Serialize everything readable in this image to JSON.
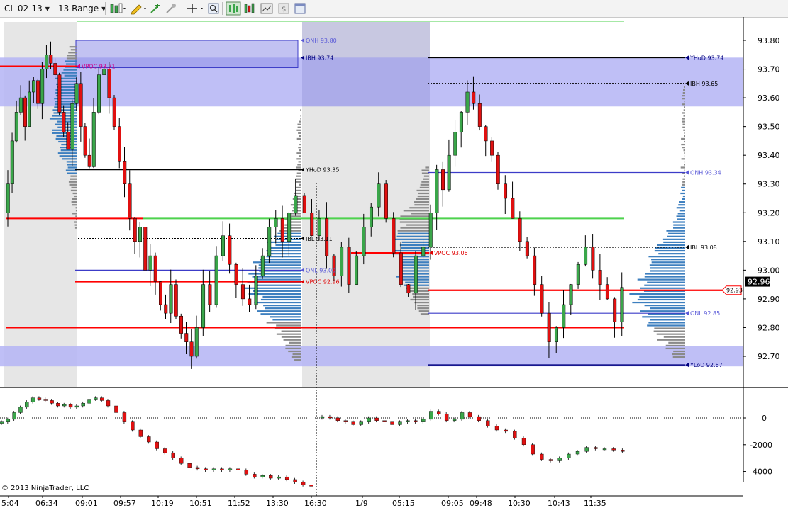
{
  "toolbar": {
    "instrument": "CL 02-13",
    "bar_type": "13 Range",
    "icons": [
      "bar-style-icon",
      "drawing-pencil-icon",
      "add-indicator-icon",
      "strategy-icon",
      "crosshair-icon",
      "zoom-icon",
      "data-box-icon",
      "chart-trader-icon",
      "chart-properties-icon",
      "dollar-icon",
      "window-icon"
    ]
  },
  "price_axis": {
    "ticks": [
      "93.80",
      "93.70",
      "93.60",
      "93.50",
      "93.40",
      "93.30",
      "93.20",
      "93.10",
      "93.00",
      "92.90",
      "92.80",
      "92.70"
    ],
    "current_price": "92.96",
    "marker_price": "92.93"
  },
  "oscillator_axis": {
    "ticks": [
      "0",
      "-2000",
      "-4000"
    ]
  },
  "time_axis": {
    "labels": [
      "5:04",
      "06:34",
      "09:01",
      "09:57",
      "10:19",
      "10:51",
      "11:52",
      "13:30",
      "16:30",
      "1/9",
      "05:15",
      "09:05",
      "09:48",
      "10:30",
      "10:43",
      "11:35"
    ]
  },
  "annotations": {
    "onh_1": "ONH 93.80",
    "ibh_1": "IBH 93.74",
    "vpoc_1": "VPOC 93.71",
    "yhod_1": "YHoD 93.35",
    "ibl_1": "IBL 93.11",
    "onl_1": "ONL 93.00",
    "vpoc_2": "VPOC 92.96",
    "yhod_2": "YHoD 93.74",
    "ibh_2": "IBH 93.65",
    "onh_2": "ONH 93.34",
    "ibl_2": "IBL 93.08",
    "vpoc_3": "VPOC 93.06",
    "onl_2": "ONL 92.85",
    "ylod": "YLoD 92.67"
  },
  "copyright": "© 2013 NinjaTrader, LLC",
  "colors": {
    "up": "#3aa64a",
    "down": "#e01010",
    "zone": "#b4b4f5",
    "profile_blue": "#3d7fbf",
    "profile_gray": "#8a8a8a",
    "vpoc": "#ff0000",
    "level_blue": "#3c3cc8"
  },
  "chart_data": [
    {
      "type": "candlestick",
      "title": "",
      "price_range": [
        92.62,
        93.86
      ],
      "price_ticks": [
        93.8,
        93.7,
        93.6,
        93.5,
        93.4,
        93.3,
        93.2,
        93.1,
        93.0,
        92.9,
        92.8,
        92.7
      ],
      "current_price": 92.96,
      "levels": [
        {
          "label": "ONH",
          "price": 93.8
        },
        {
          "label": "IBH",
          "price": 93.74
        },
        {
          "label": "VPOC",
          "price": 93.71
        },
        {
          "label": "YHoD",
          "price": 93.35
        },
        {
          "label": "IBL",
          "price": 93.11
        },
        {
          "label": "ONL",
          "price": 93.0
        },
        {
          "label": "VPOC",
          "price": 92.96
        },
        {
          "label": "YHoD",
          "price": 93.74
        },
        {
          "label": "IBH",
          "price": 93.65
        },
        {
          "label": "ONH",
          "price": 93.34
        },
        {
          "label": "IBL",
          "price": 93.08
        },
        {
          "label": "VPOC",
          "price": 93.06
        },
        {
          "label": "ONL",
          "price": 92.85
        },
        {
          "label": "YLoD",
          "price": 92.67
        }
      ]
    },
    {
      "type": "candlestick",
      "title": "",
      "value_range": [
        -5200,
        1500
      ],
      "ticks": [
        0,
        -2000,
        -4000
      ]
    }
  ]
}
